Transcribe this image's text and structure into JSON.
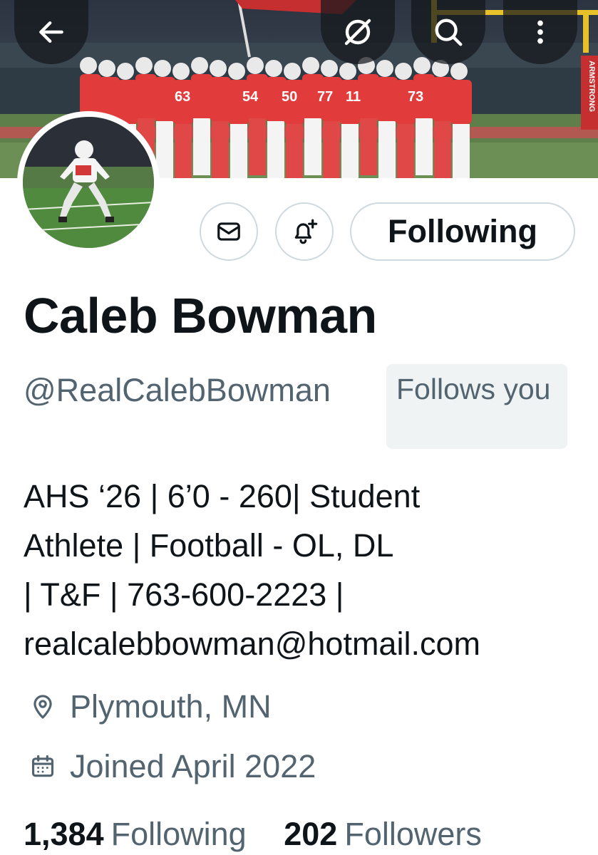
{
  "header": {
    "banner": {
      "stadium_sign": "ARMSTRONG",
      "jersey_numbers": [
        "63",
        "54",
        "50",
        "77",
        "11",
        "73"
      ]
    },
    "icons": {
      "back": "arrow-left-icon",
      "external": "link-slash-icon",
      "search": "search-icon",
      "more": "more-vertical-icon"
    }
  },
  "profile": {
    "display_name": "Caleb Bowman",
    "handle": "@RealCalebBowman",
    "follows_you": "Follows you",
    "following_button": "Following",
    "bio_lines": [
      "AHS ‘26 | 6’0 - 260| Student",
      "Athlete | Football - OL, DL",
      "| T&F | 763-600-2223 |",
      "realcalebbowman@hotmail.com"
    ],
    "location": "Plymouth, MN",
    "joined": "Joined April 2022",
    "following_count": "1,384",
    "following_label": "Following",
    "followers_count": "202",
    "followers_label": "Followers"
  },
  "colors": {
    "text_primary": "#0f1419",
    "text_secondary": "#536471",
    "border": "#cfd9de",
    "badge_bg": "#eff3f4",
    "jersey_red": "#e23b3b"
  }
}
